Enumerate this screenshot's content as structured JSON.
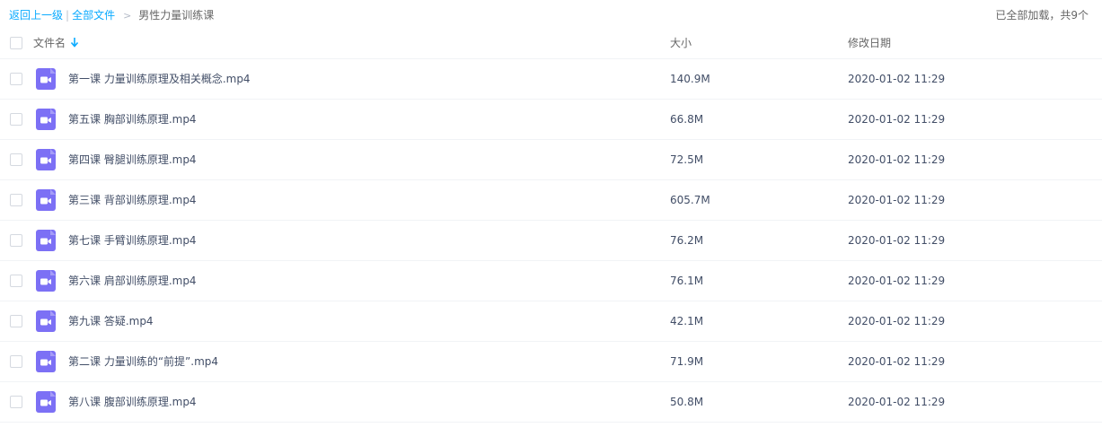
{
  "breadcrumb": {
    "back_label": "返回上一级",
    "separator": "|",
    "all_files_label": "全部文件",
    "arrow": ">",
    "current_folder": "男性力量训练课"
  },
  "load_status": "已全部加载，共9个",
  "columns": {
    "name": "文件名",
    "size": "大小",
    "modified": "修改日期"
  },
  "icons": {
    "video_file": "video-file-icon",
    "sort": "sort-arrow-down-icon"
  },
  "colors": {
    "link": "#09aaff",
    "video_icon": "#7c70f5"
  },
  "files": [
    {
      "name": "第一课 力量训练原理及相关概念.mp4",
      "size": "140.9M",
      "modified": "2020-01-02 11:29"
    },
    {
      "name": "第五课 胸部训练原理.mp4",
      "size": "66.8M",
      "modified": "2020-01-02 11:29"
    },
    {
      "name": "第四课 臀腿训练原理.mp4",
      "size": "72.5M",
      "modified": "2020-01-02 11:29"
    },
    {
      "name": "第三课 背部训练原理.mp4",
      "size": "605.7M",
      "modified": "2020-01-02 11:29"
    },
    {
      "name": "第七课 手臂训练原理.mp4",
      "size": "76.2M",
      "modified": "2020-01-02 11:29"
    },
    {
      "name": "第六课 肩部训练原理.mp4",
      "size": "76.1M",
      "modified": "2020-01-02 11:29"
    },
    {
      "name": "第九课 答疑.mp4",
      "size": "42.1M",
      "modified": "2020-01-02 11:29"
    },
    {
      "name": "第二课 力量训练的“前提”.mp4",
      "size": "71.9M",
      "modified": "2020-01-02 11:29"
    },
    {
      "name": "第八课 腹部训练原理.mp4",
      "size": "50.8M",
      "modified": "2020-01-02 11:29"
    }
  ]
}
